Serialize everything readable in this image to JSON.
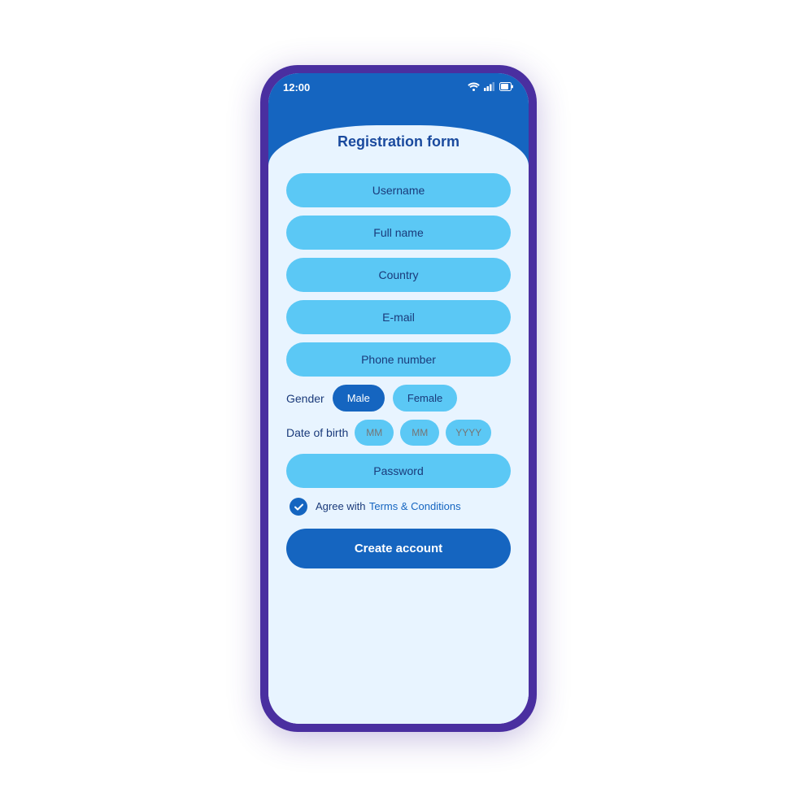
{
  "phone": {
    "statusBar": {
      "time": "12:00",
      "wifi": "wifi",
      "signal": "signal",
      "battery": "battery"
    },
    "header": {
      "title": "Registration form"
    },
    "form": {
      "username_placeholder": "Username",
      "fullname_placeholder": "Full name",
      "country_placeholder": "Country",
      "email_placeholder": "E-mail",
      "phone_placeholder": "Phone number",
      "gender_label": "Gender",
      "gender_options": [
        {
          "label": "Male",
          "active": true
        },
        {
          "label": "Female",
          "active": false
        }
      ],
      "dob_label": "Date of birth",
      "dob_month1_placeholder": "MM",
      "dob_month2_placeholder": "MM",
      "dob_year_placeholder": "YYYY",
      "password_placeholder": "Password",
      "agree_text": "Agree with",
      "agree_link": "Terms & Conditions",
      "create_button": "Create account"
    }
  }
}
